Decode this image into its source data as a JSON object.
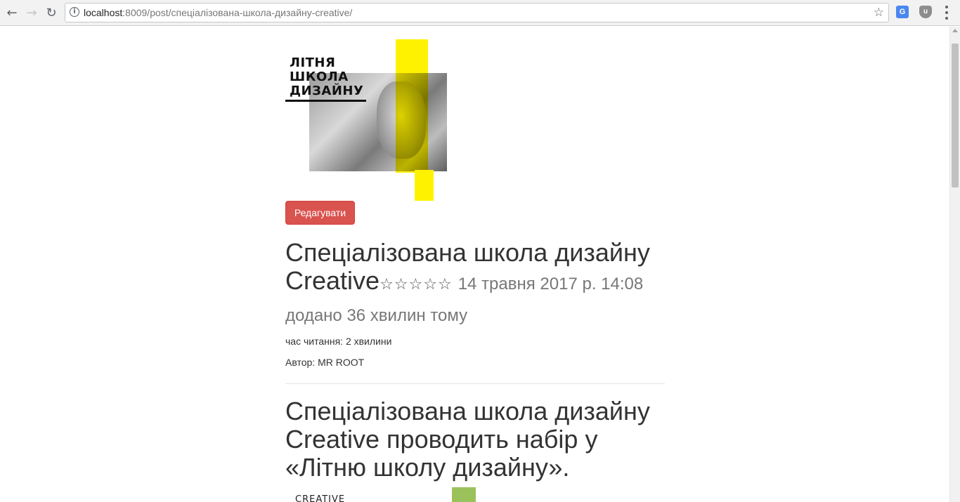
{
  "browser": {
    "url_host": "localhost",
    "url_rest": ":8009/post/спеціалізована-школа-дизайну-creative/",
    "icons": [
      "back-icon",
      "forward-icon",
      "reload-icon",
      "info-icon",
      "bookmark-star-icon",
      "translate-extension-icon",
      "ublock-extension-icon",
      "menu-icon"
    ]
  },
  "hero": {
    "logo_line1": "ЛІТНЯ",
    "logo_line2": "ШКОЛА",
    "logo_line3": "ДИЗАЙНУ",
    "accent_color": "#fff200"
  },
  "post": {
    "edit_label": "Редагувати",
    "title": "Спеціалізована школа дизайну Creative",
    "stars": "☆☆☆☆☆",
    "date": "14 травня 2017 р. 14:08",
    "added": "додано 36 хвилин тому",
    "reading_time": "час читання: 2 хвилини",
    "author": "Автор: MR ROOT",
    "heading": "Спеціалізована школа дизайну Creative проводить набір у «Літню школу дизайну».",
    "image2_text": "CREATIVE",
    "edit_color": "#d9534f"
  }
}
